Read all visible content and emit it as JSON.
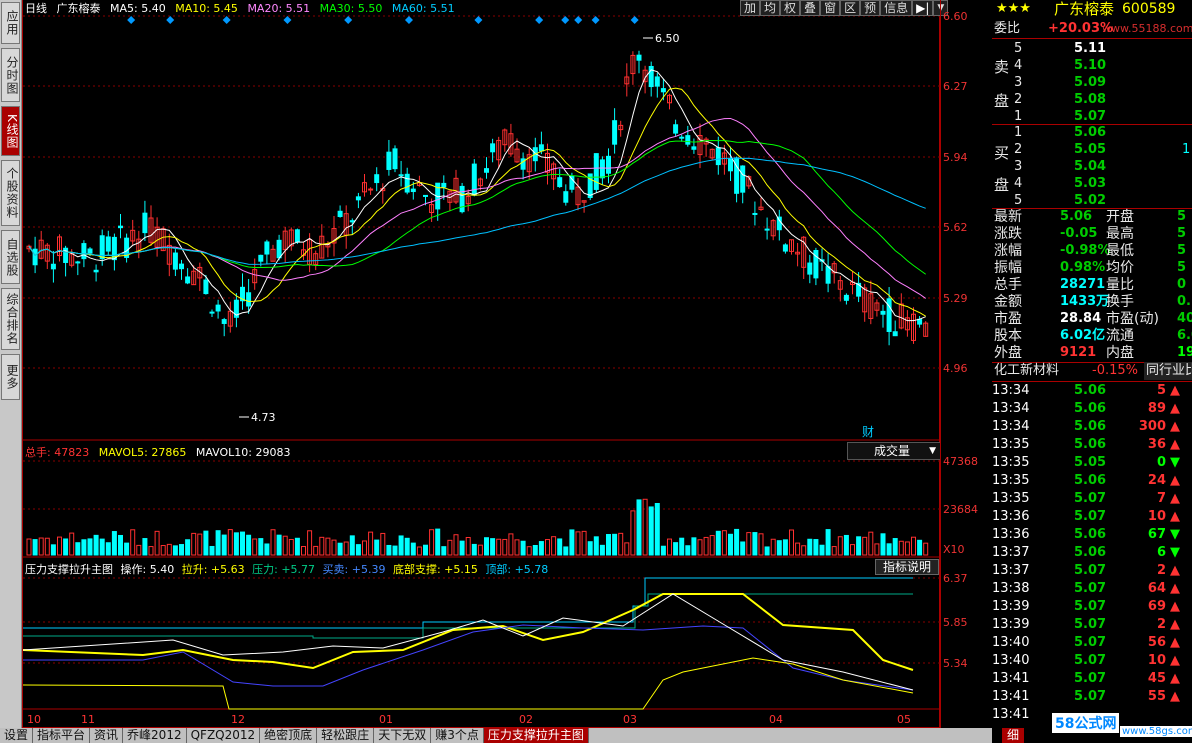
{
  "sidebar": {
    "tabs": [
      {
        "label": "应用",
        "active": false
      },
      {
        "label": "分时图",
        "active": false
      },
      {
        "label": "K线图",
        "active": true
      },
      {
        "label": "个股资料",
        "active": false
      },
      {
        "label": "自选股",
        "active": false
      },
      {
        "label": "综合排名",
        "active": false
      },
      {
        "label": "更多",
        "active": false
      }
    ]
  },
  "kline": {
    "period": "日线",
    "stock_name": "广东榕泰",
    "ma5": "MA5: 5.40",
    "ma10": "MA10: 5.45",
    "ma20": "MA20: 5.51",
    "ma30": "MA30: 5.50",
    "ma60": "MA60: 5.51",
    "high_label": "6.50",
    "low_label": "4.73",
    "finance_marker": "财",
    "price_axis": [
      "6.60",
      "6.27",
      "5.94",
      "5.62",
      "5.29",
      "4.96"
    ],
    "colors": {
      "ma5": "#ffffff",
      "ma10": "#ffff00",
      "ma20": "#ff80ff",
      "ma30": "#00ff00",
      "ma60": "#00c0ff",
      "up": "#ff3030",
      "down": "#00ffff"
    }
  },
  "toolbar": {
    "buttons": [
      "加",
      "均",
      "权",
      "叠",
      "窗",
      "区",
      "预",
      "信息"
    ]
  },
  "volume": {
    "total": "总手: 47823",
    "mavol5": "MAVOL5: 27865",
    "mavol10": "MAVOL10: 29083",
    "dropdown": "成交量",
    "axis": [
      "47368",
      "23684"
    ],
    "multiplier": "X10"
  },
  "indicator": {
    "name": "压力支撑拉升主图",
    "operate": "操作: 5.40",
    "lift": "拉升: +5.63",
    "pressure": "压力: +5.77",
    "buysell": "买卖: +5.39",
    "bottom": "底部支撑: +5.15",
    "top": "顶部: +5.78",
    "help_button": "指标说明",
    "axis": [
      "6.37",
      "5.85",
      "5.34"
    ]
  },
  "date_axis": [
    "10",
    "11",
    "12",
    "01",
    "02",
    "03",
    "04",
    "05"
  ],
  "quote": {
    "stars": "★★★",
    "name": "广东榕泰",
    "code": "600589",
    "weibi_label": "委比",
    "weibi_value": "+20.03%",
    "watermark": "www.55188.com",
    "sell_label_1": "卖",
    "sell_label_2": "盘",
    "buy_label_1": "买",
    "buy_label_2": "盘",
    "sells": [
      {
        "level": "5",
        "price": "5.11",
        "vol": ""
      },
      {
        "level": "4",
        "price": "5.10",
        "vol": ""
      },
      {
        "level": "3",
        "price": "5.09",
        "vol": ""
      },
      {
        "level": "2",
        "price": "5.08",
        "vol": ""
      },
      {
        "level": "1",
        "price": "5.07",
        "vol": ""
      }
    ],
    "buys": [
      {
        "level": "1",
        "price": "5.06",
        "vol": ""
      },
      {
        "level": "2",
        "price": "5.05",
        "vol": "1"
      },
      {
        "level": "3",
        "price": "5.04",
        "vol": ""
      },
      {
        "level": "4",
        "price": "5.03",
        "vol": ""
      },
      {
        "level": "5",
        "price": "5.02",
        "vol": ""
      }
    ],
    "stats_left": [
      {
        "label": "最新",
        "value": "5.06"
      },
      {
        "label": "涨跌",
        "value": "-0.05"
      },
      {
        "label": "涨幅",
        "value": "-0.98%"
      },
      {
        "label": "振幅",
        "value": "0.98%"
      },
      {
        "label": "总手",
        "value": "28271"
      },
      {
        "label": "金额",
        "value": "1433万"
      },
      {
        "label": "市盈",
        "value": "28.84"
      },
      {
        "label": "股本",
        "value": "6.02亿"
      },
      {
        "label": "外盘",
        "value": "9121"
      }
    ],
    "stats_right": [
      {
        "label": "开盘",
        "value": "5"
      },
      {
        "label": "最高",
        "value": "5"
      },
      {
        "label": "最低",
        "value": "5"
      },
      {
        "label": "均价",
        "value": "5"
      },
      {
        "label": "量比",
        "value": "0"
      },
      {
        "label": "换手",
        "value": "0."
      },
      {
        "label": "市盈(动)",
        "value": "40"
      },
      {
        "label": "流通",
        "value": "6.0"
      },
      {
        "label": "内盘",
        "value": "19"
      }
    ],
    "sector": "化工新材料",
    "sector_change": "-0.15%",
    "peer_label": "同行业比"
  },
  "ticks": [
    {
      "time": "13:34",
      "price": "5.06",
      "vol": "5",
      "dir": "up"
    },
    {
      "time": "13:34",
      "price": "5.06",
      "vol": "89",
      "dir": "up"
    },
    {
      "time": "13:34",
      "price": "5.06",
      "vol": "300",
      "dir": "up"
    },
    {
      "time": "13:35",
      "price": "5.06",
      "vol": "36",
      "dir": "up"
    },
    {
      "time": "13:35",
      "price": "5.05",
      "vol": "0",
      "dir": "down"
    },
    {
      "time": "13:35",
      "price": "5.06",
      "vol": "24",
      "dir": "up"
    },
    {
      "time": "13:35",
      "price": "5.07",
      "vol": "7",
      "dir": "up"
    },
    {
      "time": "13:36",
      "price": "5.07",
      "vol": "10",
      "dir": "up"
    },
    {
      "time": "13:36",
      "price": "5.06",
      "vol": "67",
      "dir": "down"
    },
    {
      "time": "13:37",
      "price": "5.06",
      "vol": "6",
      "dir": "down"
    },
    {
      "time": "13:37",
      "price": "5.07",
      "vol": "2",
      "dir": "up"
    },
    {
      "time": "13:38",
      "price": "5.07",
      "vol": "64",
      "dir": "up"
    },
    {
      "time": "13:39",
      "price": "5.07",
      "vol": "69",
      "dir": "up"
    },
    {
      "time": "13:39",
      "price": "5.07",
      "vol": "2",
      "dir": "up"
    },
    {
      "time": "13:40",
      "price": "5.07",
      "vol": "56",
      "dir": "up"
    },
    {
      "time": "13:40",
      "price": "5.07",
      "vol": "10",
      "dir": "up"
    },
    {
      "time": "13:41",
      "price": "5.07",
      "vol": "45",
      "dir": "up"
    },
    {
      "time": "13:41",
      "price": "5.07",
      "vol": "55",
      "dir": "up"
    },
    {
      "time": "13:41",
      "price": "",
      "vol": "",
      "dir": ""
    }
  ],
  "bottom_tabs": [
    {
      "label": "设置",
      "active": false
    },
    {
      "label": "指标平台",
      "active": false
    },
    {
      "label": "资讯",
      "active": false
    },
    {
      "label": "乔峰2012",
      "active": false
    },
    {
      "label": "QFZQ2012",
      "active": false
    },
    {
      "label": "绝密顶底",
      "active": false
    },
    {
      "label": "轻松跟庄",
      "active": false
    },
    {
      "label": "天下无双",
      "active": false
    },
    {
      "label": "赚3个点",
      "active": false
    },
    {
      "label": "压力支撑拉升主图",
      "active": true
    }
  ],
  "footer": {
    "detail_tab": "细",
    "site_logo": "58公式网",
    "site_url": "www.58gs.com"
  }
}
